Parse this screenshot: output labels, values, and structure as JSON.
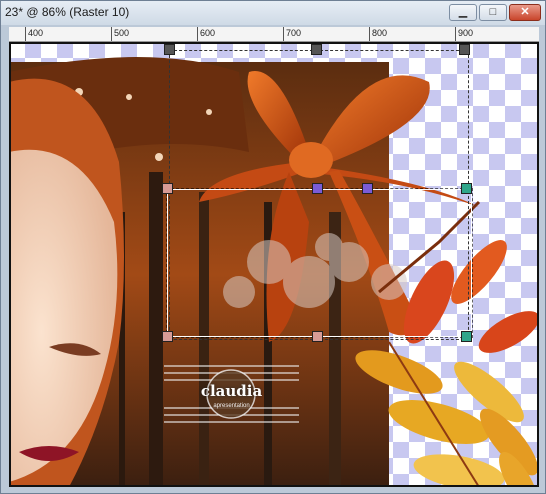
{
  "window": {
    "title": "23* @  86% (Raster 10)",
    "buttons": {
      "minimize": "▁",
      "maximize": "□",
      "close": "✕"
    }
  },
  "ruler": {
    "labels": [
      "400",
      "500",
      "600",
      "700",
      "800",
      "900"
    ]
  },
  "canvas": {
    "watermark": {
      "text": "claudia",
      "subtext": "apresentation"
    }
  },
  "colors": {
    "titlebar": "#dbe4ee",
    "checker": "#c8c8f0",
    "bow": "#d9541a",
    "leaf": "#e39a1e"
  }
}
